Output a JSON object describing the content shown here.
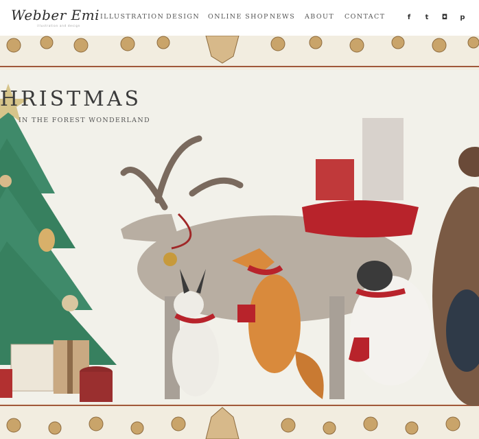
{
  "logo": {
    "text": "Webber Emi",
    "tagline": "illustration and design"
  },
  "nav": {
    "items": [
      {
        "label": "ILLUSTRATION"
      },
      {
        "label": "DESIGN"
      },
      {
        "label": "ONLINE SHOP"
      },
      {
        "label": "NEWS"
      },
      {
        "label": "ABOUT"
      },
      {
        "label": "CONTACT"
      }
    ]
  },
  "social": [
    {
      "icon": "facebook-icon",
      "glyph": "f"
    },
    {
      "icon": "twitter-icon",
      "glyph": "t"
    },
    {
      "icon": "instagram-icon",
      "glyph": "◘"
    },
    {
      "icon": "pinterest-icon",
      "glyph": "p"
    }
  ],
  "hero": {
    "title": "HRISTMAS",
    "subtitle": "IN THE FOREST WONDERLAND"
  },
  "colors": {
    "nav_text": "#555555",
    "border_red": "#a0583a",
    "tree_green": "#3f8a6a",
    "scarf_red": "#b8232b",
    "paper": "#f2f1ea"
  }
}
